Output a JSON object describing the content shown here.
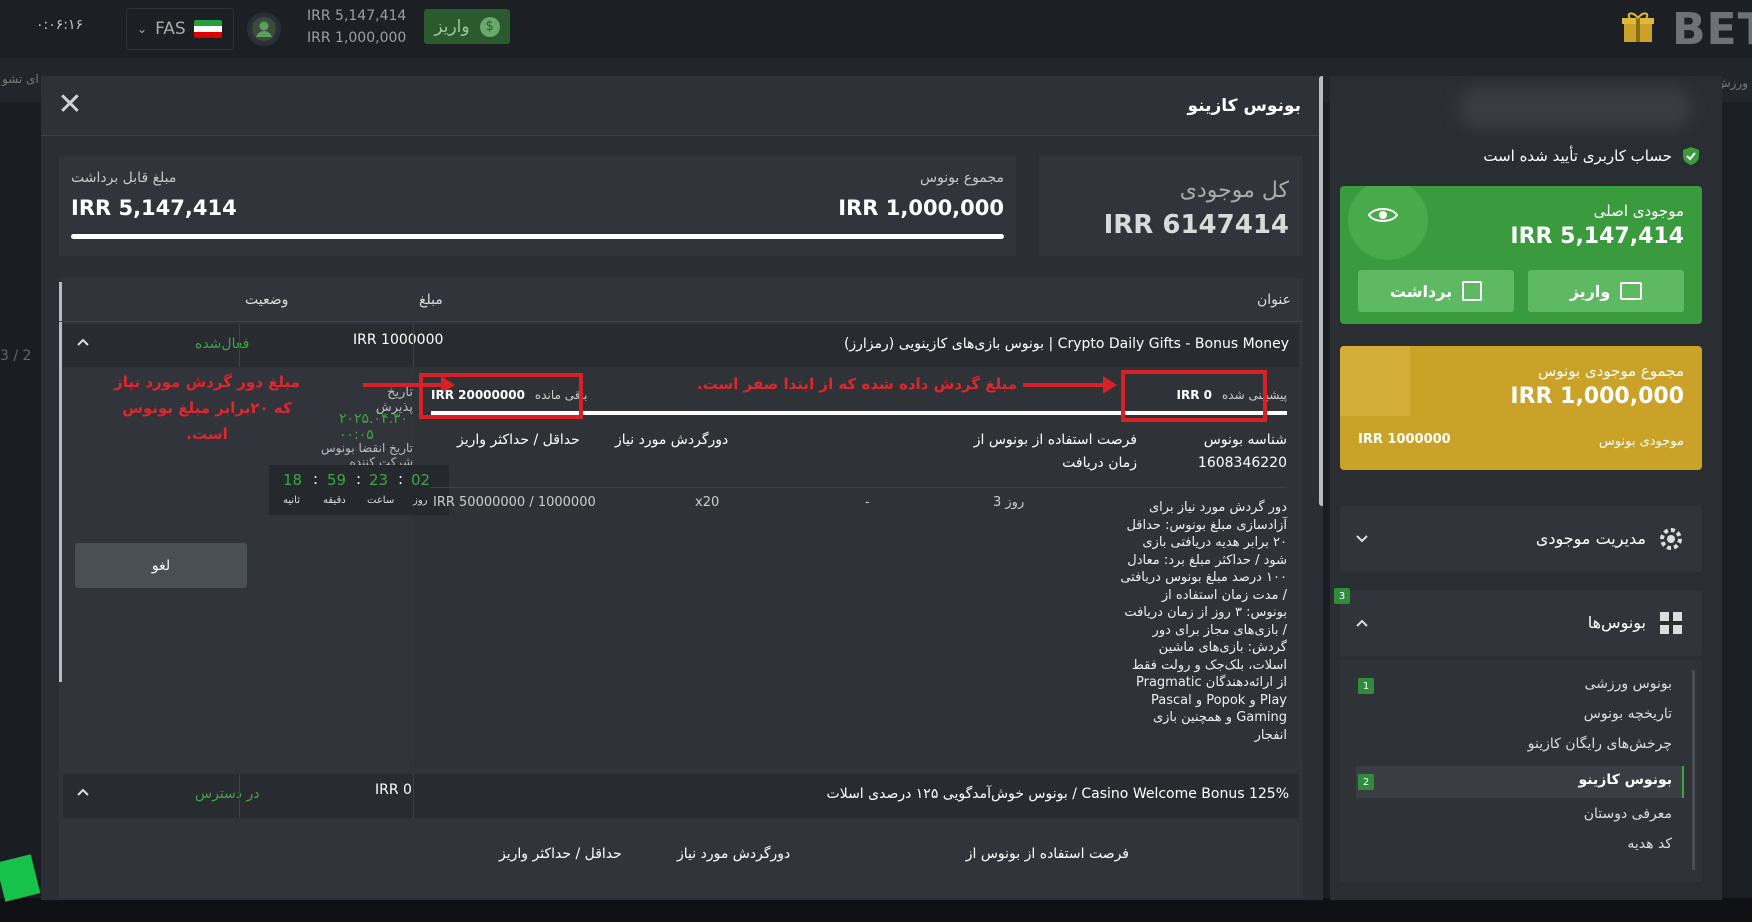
{
  "header": {
    "clock": "۰:۰۶:۱۶",
    "language": "FAS",
    "balance_main": "IRR 5,147,414",
    "balance_bonus": "IRR 1,000,000",
    "deposit_label": "واریز",
    "brand": "BET"
  },
  "background": {
    "strip_left": "ای تشو",
    "strip_right": "ورزش",
    "side_counter": "3 / 2"
  },
  "modal": {
    "title": "بونوس کازینو",
    "close_icon": "close-icon",
    "summary": {
      "withdrawable_label": "مبلغ قابل برداشت",
      "withdrawable_value": "IRR 5,147,414",
      "bonus_total_label": "مجموع بونوس",
      "bonus_total_value": "IRR 1,000,000",
      "total_label": "کل موجودی",
      "total_value": "IRR 6147414"
    },
    "table": {
      "headers": {
        "title": "عنوان",
        "amount": "مبلغ",
        "status": "وضعیت"
      },
      "rows": [
        {
          "title": "Crypto Daily Gifts - Bonus Money | بونوس بازی‌های کازینویی (رمزارز)",
          "amount": "IRR 1000000",
          "status": "فعال‌شده"
        },
        {
          "title": "Casino Welcome Bonus 125% / بونوس خوش‌آمدگویی ۱۲۵ درصدی اسلات",
          "amount": "IRR 0",
          "status": "در دسترس"
        }
      ]
    },
    "detail": {
      "accept_date_label": "تاریخ پذیرش",
      "accept_date_value": "۲۰۲۵.۰۴.۳۰ ۰۰:۰۵",
      "expire_label": "تاریخ انقضا بونوس شرکت کننده",
      "timer": {
        "days": "02",
        "hours": "23",
        "minutes": "59",
        "seconds": "18",
        "days_label": "روز",
        "hours_label": "ساعت",
        "minutes_label": "دقیقه",
        "seconds_label": "ثانیه"
      },
      "cancel_label": "لغو",
      "remaining_label": "باقی مانده",
      "remaining_value": "IRR 20000000",
      "progress_label": "پیشبینی شده",
      "progress_value": "IRR 0",
      "col_bonus_id": "شناسه بونوس",
      "bonus_id": "1608346220",
      "col_usage": "فرصت استفاده از بونوس از",
      "col_usage2": "زمان دریافت",
      "col_wager": "دورگردش مورد نیاز",
      "col_minmax": "حداقل / حداکثر واریز",
      "usage_value": "3 روز",
      "dash": "-",
      "wager_value": "x20",
      "minmax_value": "IRR 50000000 / 1000000",
      "description": "دور گردش مورد نیاز برای آزادسازی مبلغ بونوس: حداقل ۲۰ برابر هدیه دریافتی بازی شود / حداکثر مبلغ برد: معادل ۱۰۰ درصد مبلغ بونوس دریافتی / مدت زمان استفاده از بونوس: ۳ روز از زمان دریافت / بازی‌های مجاز برای دور گردش: بازی‌های ماشین اسلات، بلک‌جک و رولت فقط از ارائه‌دهندگان Pragmatic Play و Popok و Pascal Gaming و همچنین بازی انفجار"
    },
    "annotations": {
      "left": "مبلغ دور گردش مورد نیاز که ۲۰برابر مبلغ بونوس است.",
      "right": "مبلغ گردش داده شده که از ابتدا صفر است."
    }
  },
  "panel": {
    "verified": "حساب کاربری تأیید شده است",
    "main_balance_label": "موجودی اصلی",
    "main_balance_value": "IRR 5,147,414",
    "deposit_label": "واریز",
    "withdraw_label": "برداشت",
    "bonus_total_label": "مجموع موجودی بونوس",
    "bonus_total_value": "IRR 1,000,000",
    "bonus_balance_label": "موجودی بونوس",
    "bonus_balance_value": "IRR 1000000",
    "balance_management": "مدیریت موجودی",
    "bonuses": "بونوس‌ها",
    "bonuses_badge": "3",
    "sub_items": [
      {
        "label": "بونوس ورزشی",
        "badge": "1"
      },
      {
        "label": "تاریخچه بونوس",
        "badge": ""
      },
      {
        "label": "چرخش‌های رایگان کازینو",
        "badge": ""
      },
      {
        "label": "بونوس کازینو",
        "badge": "2"
      },
      {
        "label": "معرفی دوستان",
        "badge": ""
      },
      {
        "label": "کد هدیه",
        "badge": ""
      }
    ]
  },
  "colors": {
    "green": "#3a9b3e",
    "gold": "#c9a227",
    "red_annotation": "#d82026",
    "status_green": "#3fa442"
  }
}
